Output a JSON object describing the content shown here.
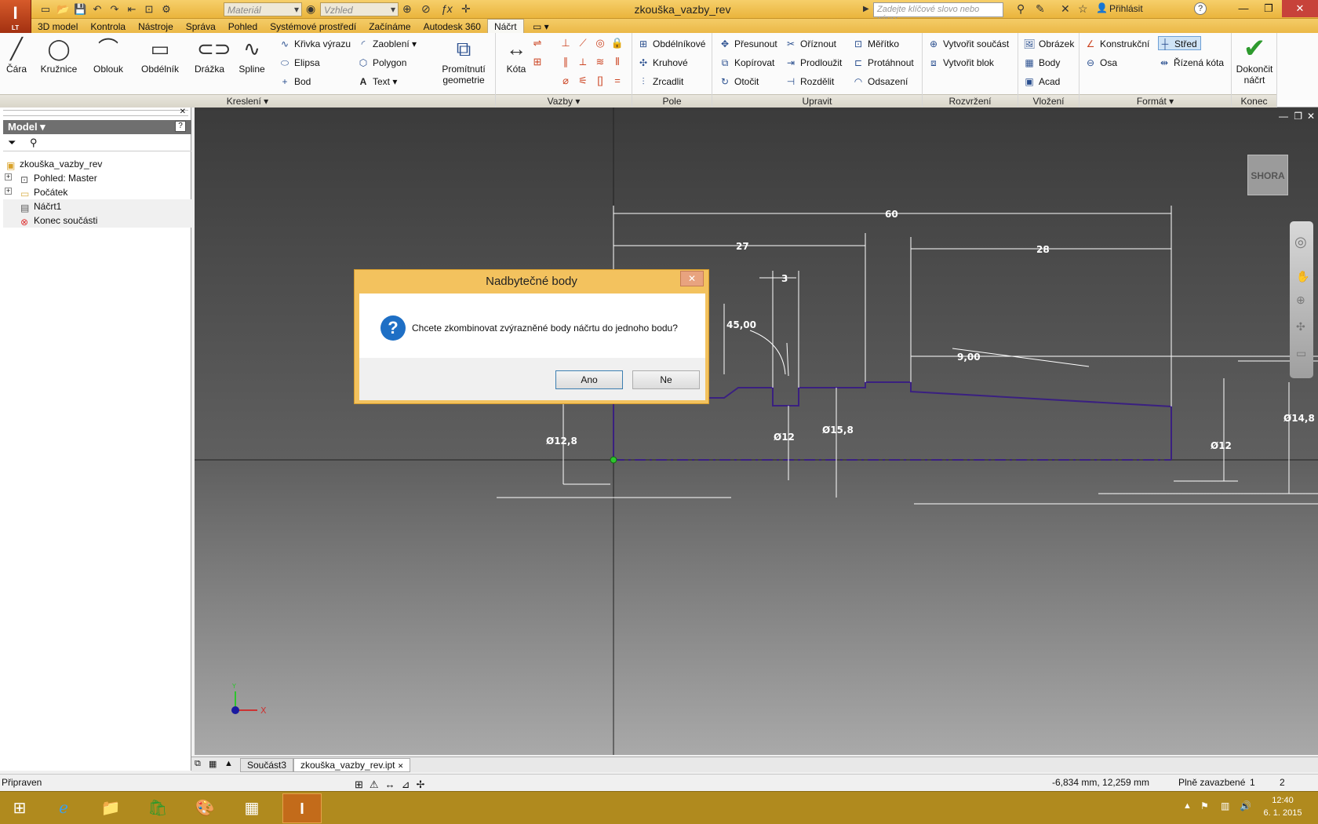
{
  "app": {
    "logo": "I",
    "logo_sub": "LT",
    "document_title": "zkouška_vazby_rev",
    "material_placeholder": "Materiál",
    "appearance_placeholder": "Vzhled",
    "search_placeholder": "Zadejte klíčové slovo nebo výraz.",
    "login_label": "Přihlásit",
    "help_label": "?"
  },
  "tabs": [
    "3D model",
    "Kontrola",
    "Nástroje",
    "Správa",
    "Pohled",
    "Systémové prostředí",
    "Začínáme",
    "Autodesk 360",
    "Náčrt"
  ],
  "active_tab": "Náčrt",
  "ribbon": {
    "kresleni": {
      "label": "Kreslení",
      "line": "Čára",
      "circle": "Kružnice",
      "arc": "Oblouk",
      "rectangle": "Obdélník",
      "slot": "Drážka",
      "spline": "Spline",
      "equation_curve": "Křivka výrazu",
      "ellipse": "Elipsa",
      "point": "Bod",
      "fillet": "Zaoblení",
      "polygon": "Polygon",
      "text": "Text",
      "project_geometry": "Promítnutí geometrie"
    },
    "vazby": {
      "label": "Vazby",
      "dimension": "Kóta"
    },
    "pole": {
      "label": "Pole",
      "rectangular": "Obdélníkové",
      "circular": "Kruhové",
      "mirror": "Zrcadlit"
    },
    "upravit": {
      "label": "Upravit",
      "move": "Přesunout",
      "copy": "Kopírovat",
      "rotate": "Otočit",
      "trim": "Oříznout",
      "extend": "Prodloužit",
      "split": "Rozdělit",
      "scale": "Měřítko",
      "stretch": "Protáhnout",
      "offset": "Odsazení"
    },
    "rozvrzeni": {
      "label": "Rozvržení",
      "create_part": "Vytvořit součást",
      "create_block": "Vytvořit blok"
    },
    "vlozeni": {
      "label": "Vložení",
      "image": "Obrázek",
      "points": "Body",
      "acad": "Acad"
    },
    "format": {
      "label": "Formát",
      "construction": "Konstrukční",
      "centerline": "Střed",
      "axis": "Osa",
      "driven_dimension": "Řízená kóta"
    },
    "konec": {
      "label": "Konec",
      "finish": "Dokončit náčrt"
    }
  },
  "browser": {
    "title": "Model",
    "tree": [
      {
        "label": "zkouška_vazby_rev",
        "level": 0,
        "icon": "part-icon",
        "expander": ""
      },
      {
        "label": "Pohled: Master",
        "level": 1,
        "icon": "view-icon",
        "expander": "+"
      },
      {
        "label": "Počátek",
        "level": 1,
        "icon": "folder-icon",
        "expander": "+"
      },
      {
        "label": "Náčrt1",
        "level": 1,
        "icon": "sketch-icon",
        "expander": ""
      },
      {
        "label": "Konec součásti",
        "level": 1,
        "icon": "end-of-part-icon",
        "expander": ""
      }
    ]
  },
  "viewport": {
    "viewcube_label": "SHORA",
    "dims": [
      "60",
      "27",
      "28",
      "3",
      "45,00",
      "9,00",
      "Ø12,8",
      "Ø12",
      "Ø15,8",
      "Ø12",
      "Ø14,8"
    ],
    "axis_x": "X",
    "axis_y": "Y"
  },
  "dialog": {
    "title": "Nadbytečné body",
    "message": "Chcete zkombinovat zvýrazněné body náčrtu do jednoho bodu?",
    "yes": "Ano",
    "no": "Ne",
    "close": "✕"
  },
  "doc_tabs": [
    "Součást3",
    "zkouška_vazby_rev.ipt"
  ],
  "active_doc_tab": "zkouška_vazby_rev.ipt",
  "status": {
    "ready": "Připraven",
    "coords": "-6,834 mm, 12,259 mm",
    "constraint_state": "Plně zavazbené",
    "count1": "1",
    "count2": "2"
  },
  "taskbar": {
    "time": "12:40",
    "date": "6. 1. 2015"
  },
  "colors": {
    "profile": "#3a2080",
    "dimension": "#ffffff",
    "title_bar": "#f3c25e"
  }
}
